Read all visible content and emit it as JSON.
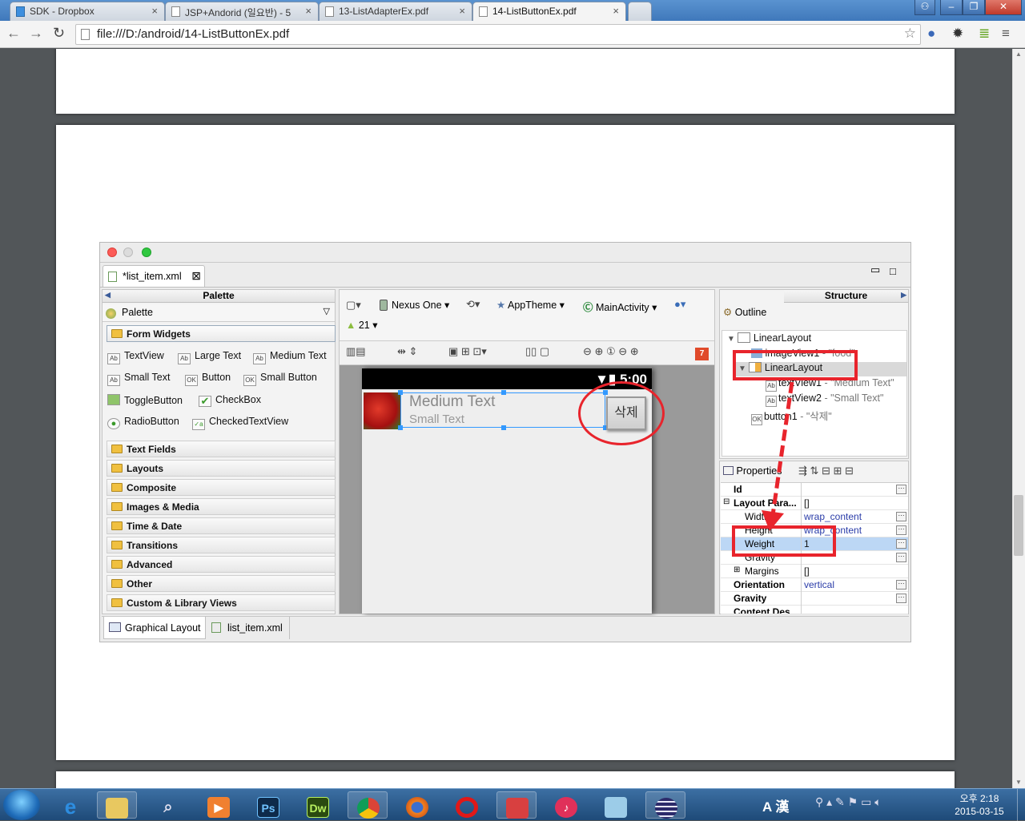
{
  "browser": {
    "tabs": [
      {
        "label": "SDK - Dropbox"
      },
      {
        "label": "JSP+Andorid (일요반) - 5"
      },
      {
        "label": "13-ListAdapterEx.pdf"
      },
      {
        "label": "14-ListButtonEx.pdf"
      }
    ],
    "url": "file:///D:/android/14-ListButtonEx.pdf"
  },
  "eclipse": {
    "editor_tab": "*list_item.xml",
    "palette": {
      "header": "Palette",
      "dropdown": "Palette",
      "form_widgets_label": "Form Widgets",
      "widgets": [
        "TextView",
        "Large Text",
        "Medium Text",
        "Small Text",
        "Button",
        "Small Button",
        "ToggleButton",
        "CheckBox",
        "RadioButton",
        "CheckedTextView"
      ],
      "categories": [
        "Text Fields",
        "Layouts",
        "Composite",
        "Images & Media",
        "Time & Date",
        "Transitions",
        "Advanced",
        "Other",
        "Custom & Library Views"
      ]
    },
    "toolbar": {
      "device": "Nexus One",
      "theme": "AppTheme",
      "activity": "MainActivity",
      "api": "21",
      "error_count": "7"
    },
    "preview": {
      "time": "5:00",
      "medium_text": "Medium Text",
      "small_text": "Small Text",
      "button_label": "삭제"
    },
    "structure": {
      "header": "Structure",
      "outline_label": "Outline",
      "tree": [
        {
          "name": "LinearLayout",
          "detail": ""
        },
        {
          "name": "imageView1",
          "detail": " - \"food\""
        },
        {
          "name": "LinearLayout",
          "detail": ""
        },
        {
          "name": "textView1",
          "detail": " - \"Medium Text\""
        },
        {
          "name": "textView2",
          "detail": " - \"Small Text\""
        },
        {
          "name": "button1",
          "detail": " - \"삭제\""
        }
      ]
    },
    "properties": {
      "label": "Properties",
      "rows": [
        {
          "key": "Id",
          "value": "",
          "bold": true
        },
        {
          "key": "Layout Para...",
          "value": "[]",
          "bold": true
        },
        {
          "key": "Width",
          "value": "wrap_content",
          "bold": false
        },
        {
          "key": "Height",
          "value": "wrap_content",
          "bold": false
        },
        {
          "key": "Weight",
          "value": "1",
          "bold": false
        },
        {
          "key": "Gravity",
          "value": "",
          "bold": false
        },
        {
          "key": "Margins",
          "value": "[]",
          "bold": false
        },
        {
          "key": "Orientation",
          "value": "vertical",
          "bold": true
        },
        {
          "key": "Gravity",
          "value": "",
          "bold": true
        },
        {
          "key": "Content Des...",
          "value": "",
          "bold": true
        }
      ]
    },
    "bottom_tabs": [
      "Graphical Layout",
      "list_item.xml"
    ]
  },
  "taskbar": {
    "ime": "A 漢",
    "time": "오후 2:18",
    "date": "2015-03-15",
    "apps": [
      "Internet Explorer",
      "Explorer",
      "Search",
      "Media",
      "Ps",
      "Dw",
      "Chrome",
      "Firefox",
      "Opera",
      "App",
      "iTunes",
      "Notepad",
      "Eclipse"
    ]
  },
  "colors": {
    "annotation_red": "#e8242c",
    "selection_blue": "#3399ff"
  }
}
